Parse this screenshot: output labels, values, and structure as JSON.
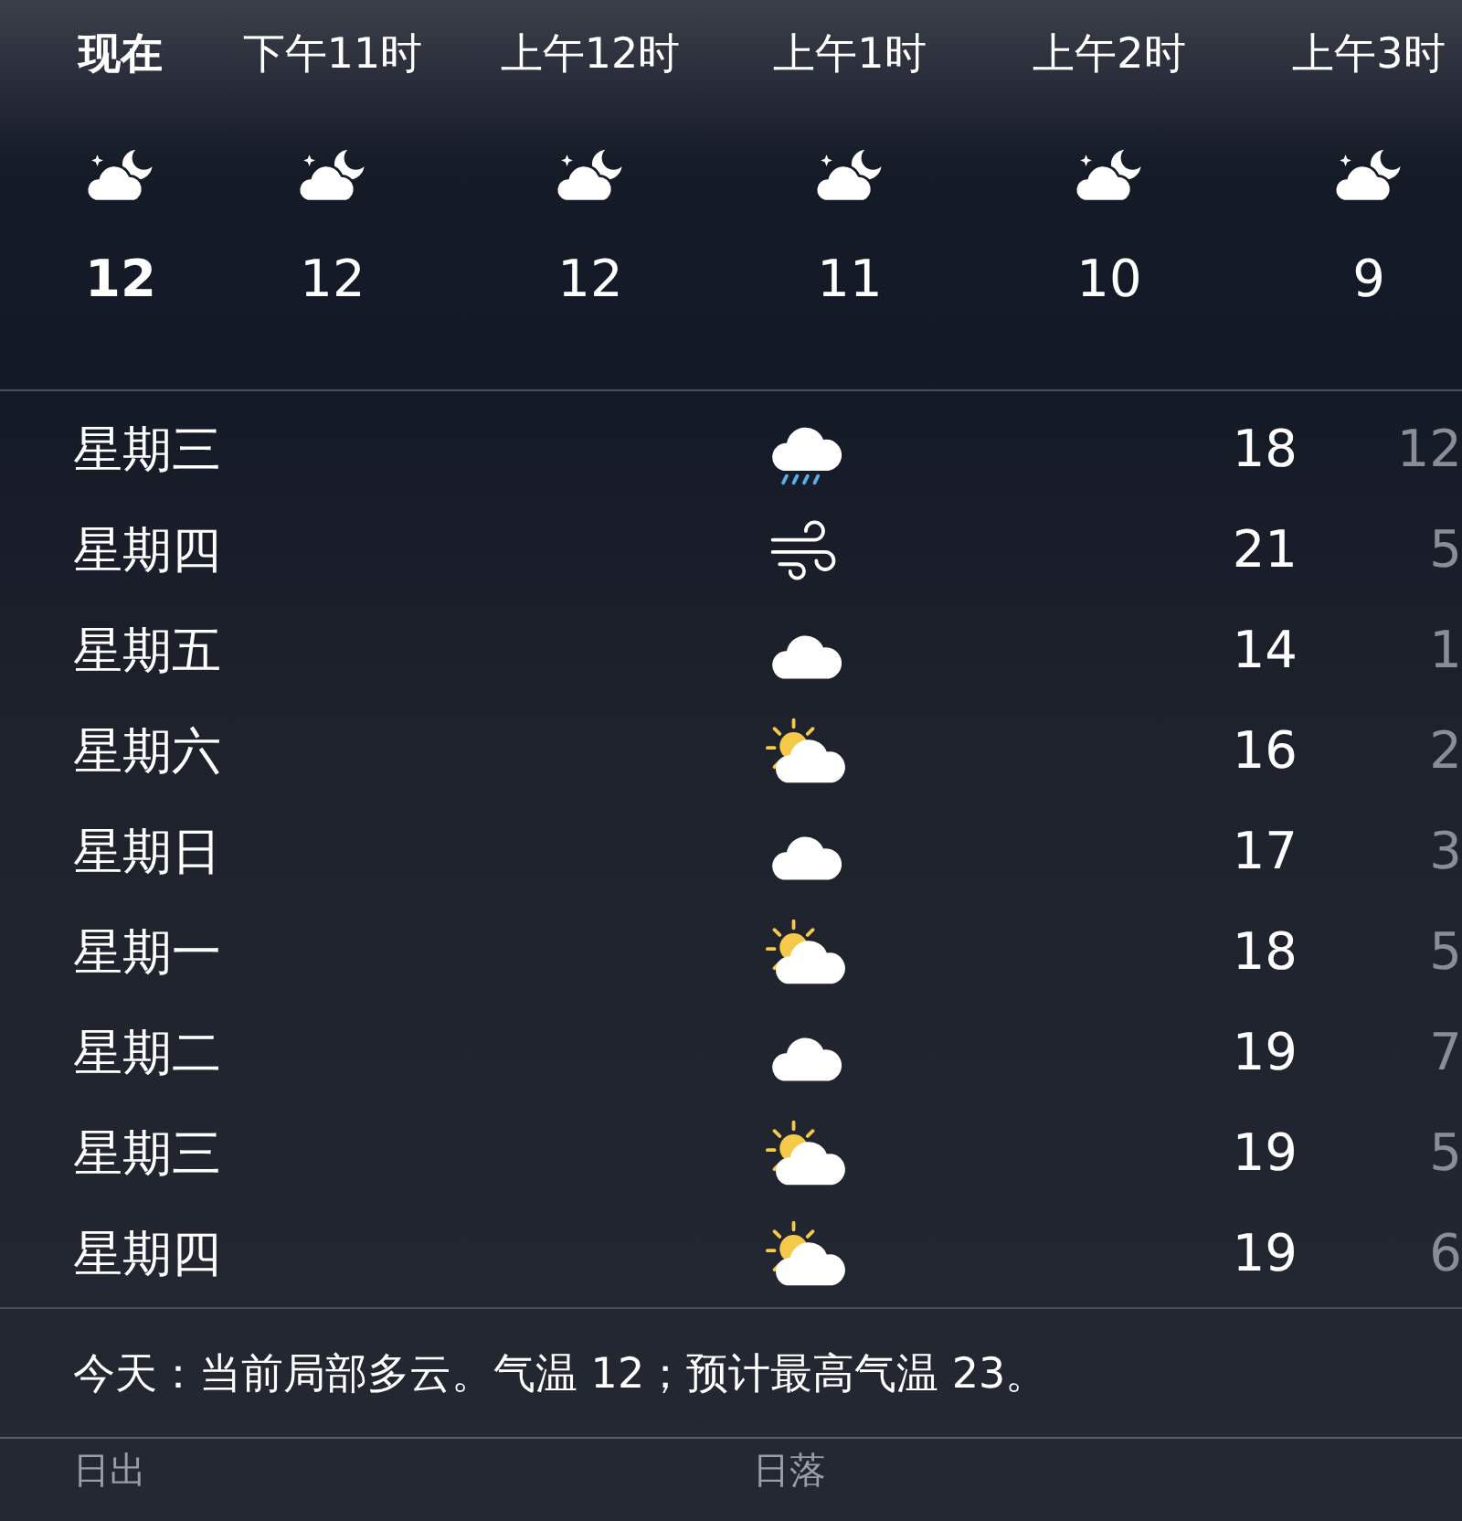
{
  "hourly": [
    {
      "time": "现在",
      "current": true,
      "kind": "night-partly-cloudy",
      "temp": "12"
    },
    {
      "time": "下午11时",
      "current": false,
      "kind": "night-partly-cloudy",
      "temp": "12"
    },
    {
      "time": "上午12时",
      "current": false,
      "kind": "night-partly-cloudy",
      "temp": "12"
    },
    {
      "time": "上午1时",
      "current": false,
      "kind": "night-partly-cloudy",
      "temp": "11"
    },
    {
      "time": "上午2时",
      "current": false,
      "kind": "night-partly-cloudy",
      "temp": "10"
    },
    {
      "time": "上午3时",
      "current": false,
      "kind": "night-partly-cloudy",
      "temp": "9"
    }
  ],
  "daily": [
    {
      "day": "星期三",
      "kind": "rain",
      "high": "18",
      "low": "12"
    },
    {
      "day": "星期四",
      "kind": "wind",
      "high": "21",
      "low": "5"
    },
    {
      "day": "星期五",
      "kind": "cloudy",
      "high": "14",
      "low": "1"
    },
    {
      "day": "星期六",
      "kind": "partly-sunny",
      "high": "16",
      "low": "2"
    },
    {
      "day": "星期日",
      "kind": "cloudy",
      "high": "17",
      "low": "3"
    },
    {
      "day": "星期一",
      "kind": "partly-sunny",
      "high": "18",
      "low": "5"
    },
    {
      "day": "星期二",
      "kind": "cloudy",
      "high": "19",
      "low": "7"
    },
    {
      "day": "星期三",
      "kind": "partly-sunny",
      "high": "19",
      "low": "5"
    },
    {
      "day": "星期四",
      "kind": "partly-sunny",
      "high": "19",
      "low": "6"
    }
  ],
  "summary": "今天：当前局部多云。气温 12；预计最高气温 23。",
  "details": [
    {
      "label": "日出"
    },
    {
      "label": "日落"
    }
  ]
}
